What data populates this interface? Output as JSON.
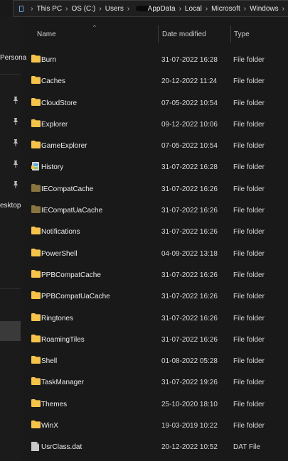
{
  "address": {
    "segments": [
      "This PC",
      "OS (C:)",
      "Users",
      "AppData",
      "Local",
      "Microsoft",
      "Windows"
    ]
  },
  "nav": {
    "items": [
      "Persona",
      "esktop"
    ]
  },
  "header": {
    "name": "Name",
    "date": "Date modified",
    "type": "Type",
    "sort_glyph": "^"
  },
  "rows": [
    {
      "name": "Burn",
      "date": "31-07-2022 16:28",
      "type": "File folder",
      "icon": "folder-icon"
    },
    {
      "name": "Caches",
      "date": "20-12-2022 11:24",
      "type": "File folder",
      "icon": "folder-icon"
    },
    {
      "name": "CloudStore",
      "date": "07-05-2022 10:54",
      "type": "File folder",
      "icon": "folder-icon"
    },
    {
      "name": "Explorer",
      "date": "09-12-2022 10:06",
      "type": "File folder",
      "icon": "folder-icon"
    },
    {
      "name": "GameExplorer",
      "date": "07-05-2022 10:54",
      "type": "File folder",
      "icon": "folder-icon"
    },
    {
      "name": "History",
      "date": "31-07-2022 16:28",
      "type": "File folder",
      "icon": "history-folder-icon"
    },
    {
      "name": "IECompatCache",
      "date": "31-07-2022 16:26",
      "type": "File folder",
      "icon": "dim-folder-icon"
    },
    {
      "name": "IECompatUaCache",
      "date": "31-07-2022 16:26",
      "type": "File folder",
      "icon": "dim-folder-icon"
    },
    {
      "name": "Notifications",
      "date": "31-07-2022 16:26",
      "type": "File folder",
      "icon": "folder-icon"
    },
    {
      "name": "PowerShell",
      "date": "04-09-2022 13:18",
      "type": "File folder",
      "icon": "folder-icon"
    },
    {
      "name": "PPBCompatCache",
      "date": "31-07-2022 16:26",
      "type": "File folder",
      "icon": "folder-icon"
    },
    {
      "name": "PPBCompatUaCache",
      "date": "31-07-2022 16:26",
      "type": "File folder",
      "icon": "folder-icon"
    },
    {
      "name": "Ringtones",
      "date": "31-07-2022 16:26",
      "type": "File folder",
      "icon": "folder-icon"
    },
    {
      "name": "RoamingTiles",
      "date": "31-07-2022 16:26",
      "type": "File folder",
      "icon": "folder-icon"
    },
    {
      "name": "Shell",
      "date": "01-08-2022 05:28",
      "type": "File folder",
      "icon": "folder-icon"
    },
    {
      "name": "TaskManager",
      "date": "31-07-2022 19:26",
      "type": "File folder",
      "icon": "folder-icon"
    },
    {
      "name": "Themes",
      "date": "25-10-2020 18:10",
      "type": "File folder",
      "icon": "folder-icon"
    },
    {
      "name": "WinX",
      "date": "19-03-2019 10:22",
      "type": "File folder",
      "icon": "folder-icon"
    },
    {
      "name": "UsrClass.dat",
      "date": "20-12-2022 10:52",
      "type": "DAT File",
      "icon": "file-icon"
    }
  ],
  "colors": {
    "folder": "#f6c34a",
    "folder_dim": "#8a7440",
    "background": "#191919",
    "pc_icon": "#6aa6e0"
  }
}
